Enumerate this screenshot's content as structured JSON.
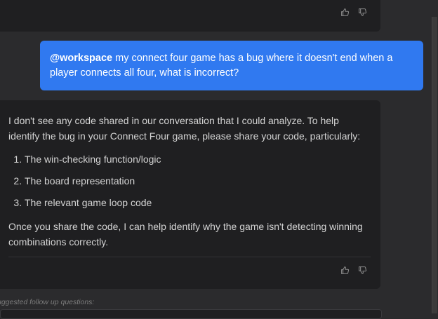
{
  "previous_message": {
    "feedback": {
      "thumbs_up_icon": "thumbs-up-icon",
      "thumbs_down_icon": "thumbs-down-icon"
    }
  },
  "user_message": {
    "mention": "@workspace",
    "text": " my connect four game has a bug where it doesn't end when a player connects all four, what is incorrect?"
  },
  "assistant_message": {
    "intro": "I don't see any code shared in our conversation that I could analyze. To help identify the bug in your Connect Four game, please share your code, particularly:",
    "items": [
      "The win-checking function/logic",
      "The board representation",
      "The relevant game loop code"
    ],
    "outro": "Once you share the code, I can help identify why the game isn't detecting winning combinations correctly."
  },
  "followups": {
    "label": "uggested follow up questions:"
  },
  "colors": {
    "background": "#2b2b2d",
    "card": "#1f1f21",
    "user_bubble": "#3079f0",
    "text": "#d4d4d4"
  }
}
